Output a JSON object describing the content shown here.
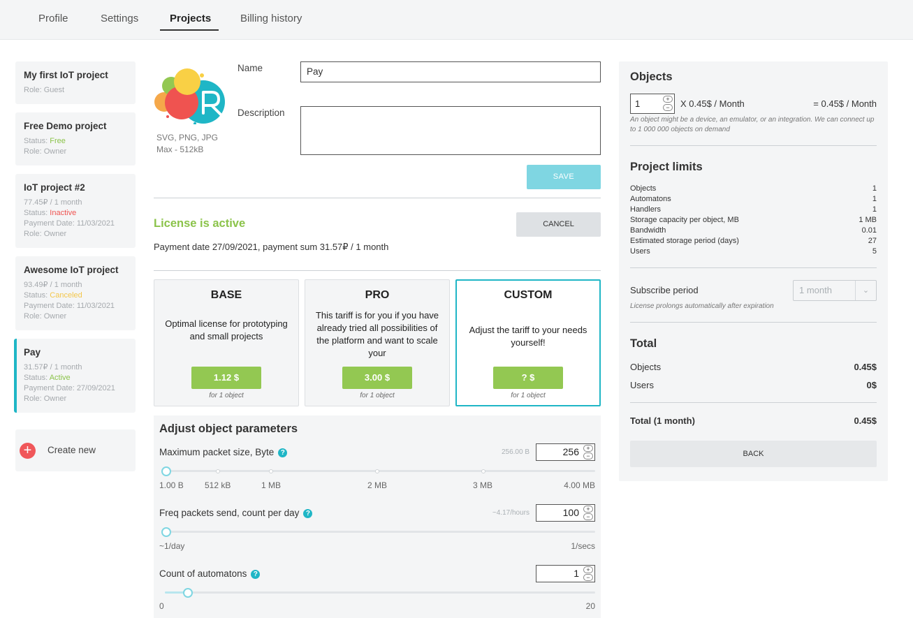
{
  "tabs": [
    {
      "label": "Profile"
    },
    {
      "label": "Settings"
    },
    {
      "label": "Projects"
    },
    {
      "label": "Billing history"
    }
  ],
  "projects": [
    {
      "title": "My first IoT project",
      "role": "Role: Guest"
    },
    {
      "title": "Free Demo project",
      "status_prefix": "Status: ",
      "status": "Free",
      "role": "Role: Owner"
    },
    {
      "title": "IoT project #2",
      "price": "77.45₽ / 1 month",
      "status_prefix": "Status: ",
      "status": "Inactive",
      "payment": "Payment Date: 11/03/2021",
      "role": "Role: Owner"
    },
    {
      "title": "Awesome IoT project",
      "price": "93.49₽ / 1 month",
      "status_prefix": "Status: ",
      "status": "Canceled",
      "payment": "Payment Date: 11/03/2021",
      "role": "Role: Owner"
    },
    {
      "title": "Pay",
      "price": "31.57₽ / 1 month",
      "status_prefix": "Status: ",
      "status": "Active",
      "payment": "Payment Date: 27/09/2021",
      "role": "Role: Owner"
    }
  ],
  "create_new": {
    "icon": "+",
    "label": "Create new"
  },
  "logo": {
    "formats": "SVG, PNG, JPG",
    "max": "Max - 512kB"
  },
  "form": {
    "name_label": "Name",
    "name_value": "Pay",
    "description_label": "Description",
    "description_value": "",
    "save_label": "SAVE"
  },
  "license": {
    "status": "License is active",
    "payment": "Payment date 27/09/2021, payment sum 31.57₽ / 1 month",
    "cancel_label": "CANCEL"
  },
  "tariffs": [
    {
      "name": "BASE",
      "description": "Optimal license for prototyping and small projects",
      "price": "1.12 $",
      "per": "for 1 object"
    },
    {
      "name": "PRO",
      "description": "This tariff is for you if you have already tried all possibilities of the platform and want to scale your",
      "price": "3.00 $",
      "per": "for 1 object"
    },
    {
      "name": "CUSTOM",
      "description": "Adjust the tariff to your needs yourself!",
      "price": "? $",
      "per": "for 1 object"
    }
  ],
  "adjust": {
    "title": "Adjust object parameters",
    "help_icon": "?",
    "spin_up": "+",
    "spin_down": "−",
    "packet": {
      "label": "Maximum packet size, Byte",
      "hint": "256.00 B",
      "value": "256",
      "slider_fraction": 0.0,
      "scale": [
        "1.00 B",
        "512 kB",
        "1 MB",
        "2 MB",
        "3 MB",
        "4.00 MB"
      ]
    },
    "freq": {
      "label": "Freq packets send, count per day",
      "hint": "~4.17/hours",
      "value": "100",
      "slider_fraction": 0.0,
      "scale_min": "~1/day",
      "scale_max": "1/secs"
    },
    "automatons": {
      "label": "Count of automatons",
      "value": "1",
      "slider_fraction": 0.05,
      "scale_min": "0",
      "scale_max": "20"
    }
  },
  "objects_panel": {
    "title": "Objects",
    "qty": "1",
    "rate": "X 0.45$ / Month",
    "total": "= 0.45$ / Month",
    "note": "An object might be a device, an emulator, or an integration. We can connect up to 1 000 000 objects on demand"
  },
  "limits": {
    "title": "Project limits",
    "rows": [
      {
        "name": "Objects",
        "value": "1"
      },
      {
        "name": "Automatons",
        "value": "1"
      },
      {
        "name": "Handlers",
        "value": "1"
      },
      {
        "name": "Storage capacity per object, MB",
        "value": "1 MB"
      },
      {
        "name": "Bandwidth",
        "value": "0.01"
      },
      {
        "name": "Estimated storage period (days)",
        "value": "27"
      },
      {
        "name": "Users",
        "value": "5"
      }
    ]
  },
  "subscribe": {
    "label": "Subscribe period",
    "selected": "1 month",
    "note": "License prolongs automatically after expiration"
  },
  "total": {
    "title": "Total",
    "rows": [
      {
        "name": "Objects",
        "value": "0.45$"
      },
      {
        "name": "Users",
        "value": "0$"
      }
    ],
    "grand_label": "Total (1 month)",
    "grand_value": "0.45$",
    "back_label": "BACK"
  },
  "colors": {
    "accent": "#1fb6c6",
    "green": "#8bc34a",
    "price_button": "#93c852",
    "save_button": "#7fd6e2",
    "inactive": "#ef5350",
    "canceled": "#f3c64a",
    "create_new": "#f0575a"
  }
}
